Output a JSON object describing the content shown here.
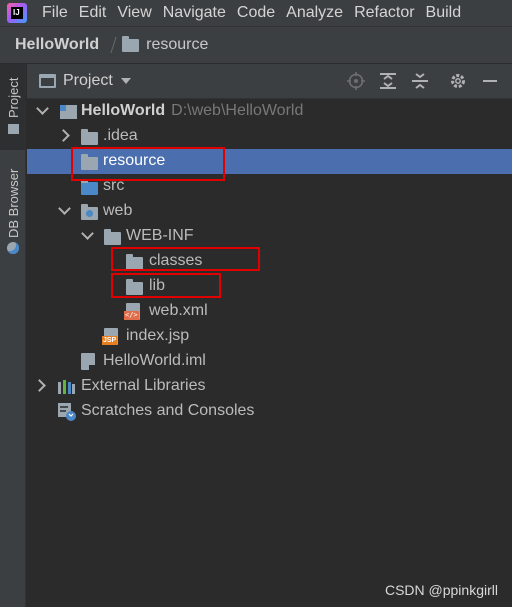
{
  "menu": {
    "app_icon_text": "IJ",
    "items": [
      "File",
      "Edit",
      "View",
      "Navigate",
      "Code",
      "Analyze",
      "Refactor",
      "Build"
    ]
  },
  "breadcrumb": {
    "project": "HelloWorld",
    "folder": "resource"
  },
  "sidebar": {
    "tabs": [
      "Project",
      "DB Browser"
    ]
  },
  "panel": {
    "title": "Project",
    "tools": [
      "locate-icon",
      "expand-all-icon",
      "collapse-all-icon",
      "gear-icon",
      "minimize-icon"
    ]
  },
  "tree": {
    "root_name": "HelloWorld",
    "root_path": "D:\\web\\HelloWorld",
    "idea": ".idea",
    "resource": "resource",
    "src": "src",
    "web": "web",
    "webinf": "WEB-INF",
    "classes": "classes",
    "lib": "lib",
    "webxml": "web.xml",
    "indexjsp": "index.jsp",
    "iml": "HelloWorld.iml",
    "ext_libs": "External Libraries",
    "scratches": "Scratches and Consoles"
  },
  "icon_badges": {
    "xml": "</>",
    "jsp": "JSP"
  },
  "selected_item": "resource",
  "highlighted_items": [
    "resource",
    "classes",
    "lib"
  ],
  "colors": {
    "background": "#2b2b2b",
    "toolbar": "#3c3f41",
    "selection": "#4b6eaf",
    "highlight_box": "#e00000",
    "folder_icon": "#9aa7b0"
  },
  "watermark": "CSDN @ppinkgirll"
}
